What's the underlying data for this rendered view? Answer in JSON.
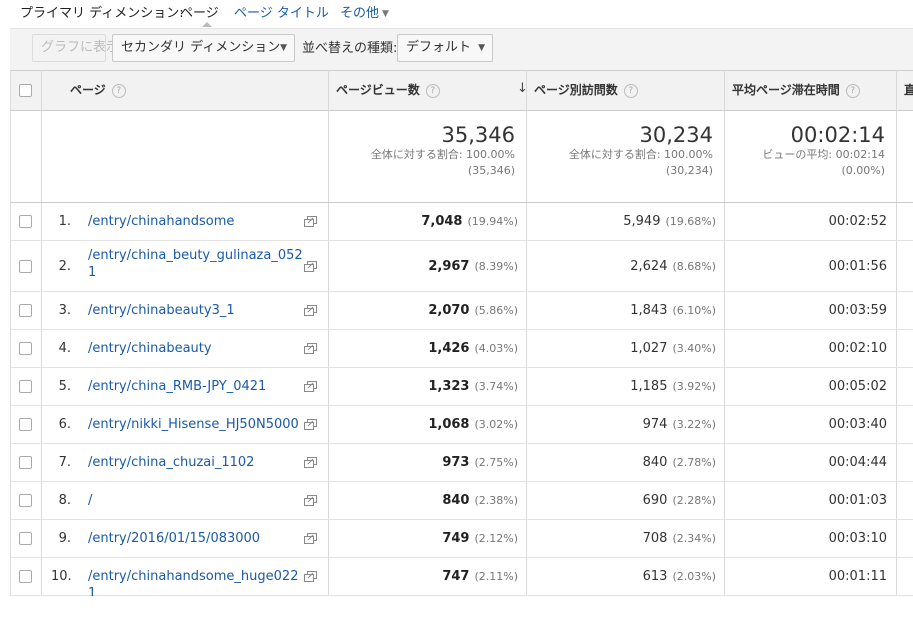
{
  "dimension_bar": {
    "label": "プライマリ ディメンション:",
    "active": "ページ",
    "options": [
      "ページ タイトル",
      "その他"
    ]
  },
  "toolbar": {
    "graph_button": "グラフに表示",
    "secondary_dimension": "セカンダリ ディメンション",
    "sort_label": "並べ替えの種類:",
    "sort_value": "デフォルト"
  },
  "table": {
    "headers": {
      "page": "ページ",
      "pageviews": "ページビュー数",
      "unique_pageviews": "ページ別訪問数",
      "avg_time": "平均ページ滞在時間",
      "next": "直"
    },
    "totals": {
      "pageviews": {
        "value": "35,346",
        "line1": "全体に対する割合: 100.00%",
        "line2": "(35,346)"
      },
      "unique_pageviews": {
        "value": "30,234",
        "line1": "全体に対する割合: 100.00%",
        "line2": "(30,234)"
      },
      "avg_time": {
        "value": "00:02:14",
        "line1": "ビューの平均: 00:02:14",
        "line2": "(0.00%)"
      }
    },
    "rows": [
      {
        "num": "1.",
        "page": "/entry/chinahandsome",
        "pv": "7,048",
        "pv_pct": "(19.94%)",
        "uv": "5,949",
        "uv_pct": "(19.68%)",
        "time": "00:02:52"
      },
      {
        "num": "2.",
        "page": "/entry/china_beuty_gulinaza_0521",
        "pv": "2,967",
        "pv_pct": "(8.39%)",
        "uv": "2,624",
        "uv_pct": "(8.68%)",
        "time": "00:01:56"
      },
      {
        "num": "3.",
        "page": "/entry/chinabeauty3_1",
        "pv": "2,070",
        "pv_pct": "(5.86%)",
        "uv": "1,843",
        "uv_pct": "(6.10%)",
        "time": "00:03:59"
      },
      {
        "num": "4.",
        "page": "/entry/chinabeauty",
        "pv": "1,426",
        "pv_pct": "(4.03%)",
        "uv": "1,027",
        "uv_pct": "(3.40%)",
        "time": "00:02:10"
      },
      {
        "num": "5.",
        "page": "/entry/china_RMB-JPY_0421",
        "pv": "1,323",
        "pv_pct": "(3.74%)",
        "uv": "1,185",
        "uv_pct": "(3.92%)",
        "time": "00:05:02"
      },
      {
        "num": "6.",
        "page": "/entry/nikki_Hisense_HJ50N5000",
        "pv": "1,068",
        "pv_pct": "(3.02%)",
        "uv": "974",
        "uv_pct": "(3.22%)",
        "time": "00:03:40"
      },
      {
        "num": "7.",
        "page": "/entry/china_chuzai_1102",
        "pv": "973",
        "pv_pct": "(2.75%)",
        "uv": "840",
        "uv_pct": "(2.78%)",
        "time": "00:04:44"
      },
      {
        "num": "8.",
        "page": "/",
        "pv": "840",
        "pv_pct": "(2.38%)",
        "uv": "690",
        "uv_pct": "(2.28%)",
        "time": "00:01:03"
      },
      {
        "num": "9.",
        "page": "/entry/2016/01/15/083000",
        "pv": "749",
        "pv_pct": "(2.12%)",
        "uv": "708",
        "uv_pct": "(2.34%)",
        "time": "00:03:10"
      },
      {
        "num": "10.",
        "page": "/entry/chinahandsome_huge0221",
        "pv": "747",
        "pv_pct": "(2.11%)",
        "uv": "613",
        "uv_pct": "(2.03%)",
        "time": "00:01:11"
      }
    ]
  }
}
